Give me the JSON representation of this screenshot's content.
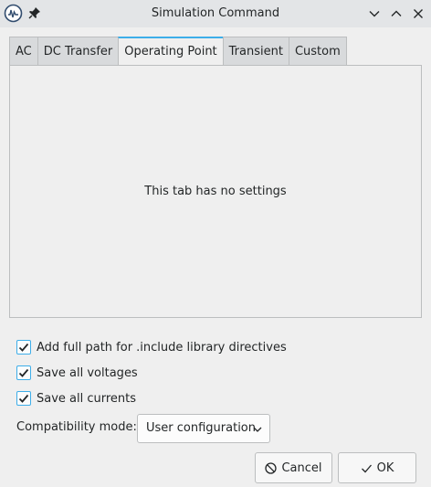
{
  "window": {
    "title": "Simulation Command",
    "icons": {
      "app": "kicad-app-icon",
      "pin": "pin-icon",
      "minimize": "chevron-down-icon",
      "maximize": "chevron-up-icon",
      "close": "close-icon"
    }
  },
  "tabs": [
    {
      "label": "AC",
      "active": false
    },
    {
      "label": "DC Transfer",
      "active": false
    },
    {
      "label": "Operating Point",
      "active": true
    },
    {
      "label": "Transient",
      "active": false
    },
    {
      "label": "Custom",
      "active": false
    }
  ],
  "panel": {
    "message": "This tab has no settings"
  },
  "options": [
    {
      "label": "Add full path for .include library directives",
      "checked": true
    },
    {
      "label": "Save all voltages",
      "checked": true
    },
    {
      "label": "Save all currents",
      "checked": true
    }
  ],
  "compatibility": {
    "label": "Compatibility mode:",
    "value": "User configuration"
  },
  "buttons": {
    "cancel": "Cancel",
    "ok": "OK"
  },
  "colors": {
    "accent": "#3daee9",
    "background": "#efefef",
    "titlebar": "#e3e5e7",
    "text": "#232627"
  }
}
